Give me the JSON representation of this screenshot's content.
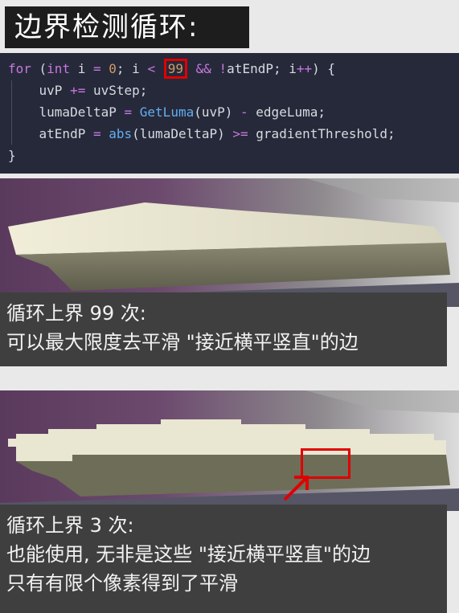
{
  "title": "边界检测循环:",
  "code": {
    "line1": {
      "for": "for",
      "open": " (",
      "int": "int",
      "mid1": " i ",
      "eq": "=",
      "mid2": " ",
      "zero": "0",
      "mid3": "; i ",
      "lt": "<",
      "limit": "99",
      "and": "&&",
      "not": "!",
      "tail": "atEndP; i",
      "inc": "++",
      "close": ") {"
    },
    "line2": {
      "a": "    uvP ",
      "op": "+=",
      "b": " uvStep;"
    },
    "line3": {
      "a": "    lumaDeltaP ",
      "eq": "=",
      "sp": " ",
      "fn": "GetLuma",
      "b": "(uvP) ",
      "minus": "-",
      "c": " edgeLuma;"
    },
    "line4": {
      "a": "    atEndP ",
      "eq": "=",
      "sp": " ",
      "fn": "abs",
      "b": "(lumaDeltaP) ",
      "ge": ">=",
      "c": " gradientThreshold;"
    },
    "line5": "}"
  },
  "caption1": {
    "line1": "循环上界 99 次:",
    "line2": "可以最大限度去平滑 \"接近横平竖直\"的边"
  },
  "caption2": {
    "line1": "循环上界 3 次:",
    "line2": "也能使用, 无非是这些 \"接近横平竖直\"的边",
    "line3": "只有有限个像素得到了平滑"
  },
  "colors": {
    "code_bg": "#26293a",
    "keyword": "#c678dd",
    "number": "#d19a66",
    "function": "#61afef",
    "highlight": "#e00000",
    "caption_bg": "#3f3f3f"
  }
}
